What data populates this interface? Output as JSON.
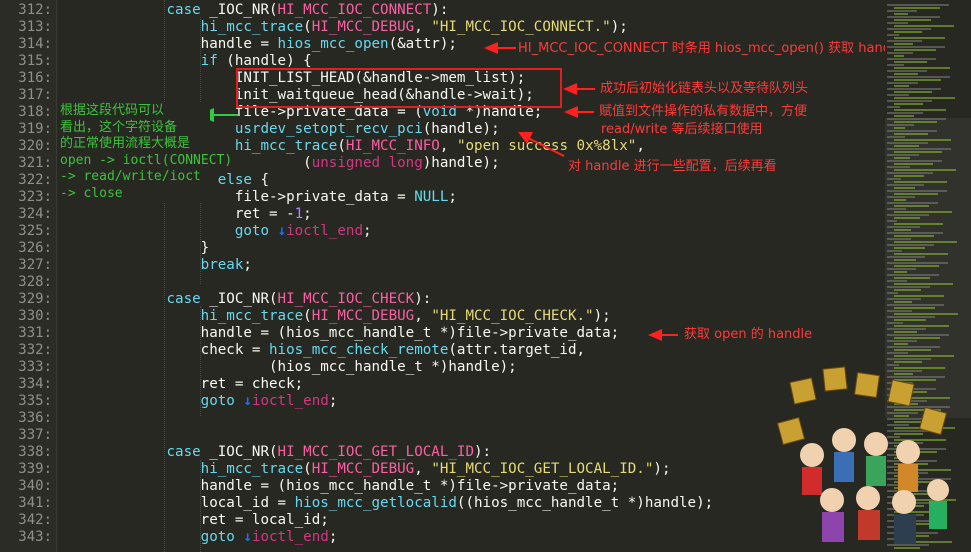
{
  "editor": {
    "lines": [
      {
        "n": "312:",
        "html": "            <span class=\"kw\">case</span> _IOC_NR(<span class=\"mac\">HI_MCC_IOC_CONNECT</span>):"
      },
      {
        "n": "313:",
        "html": "                <span class=\"fn\">hi_mcc_trace</span>(<span class=\"mac\">HI_MCC_DEBUG</span>, <span class=\"str\">\"HI_MCC_IOC_CONNECT.\"</span>);"
      },
      {
        "n": "314:",
        "html": "                handle = <span class=\"fn\">hios_mcc_open</span>(&amp;attr);"
      },
      {
        "n": "315:",
        "html": "                <span class=\"kw\">if</span> (handle) {"
      },
      {
        "n": "316:",
        "html": "                    INIT_LIST_HEAD(&amp;handle-&gt;mem_list);"
      },
      {
        "n": "317:",
        "html": "                    init_waitqueue_head(&amp;handle-&gt;wait);"
      },
      {
        "n": "318:",
        "html": "                    file-&gt;private_data = (<span class=\"kw\">void</span> *)handle;"
      },
      {
        "n": "319:",
        "html": "                    <span class=\"fn\">usrdev_setopt_recv_pci</span>(handle);"
      },
      {
        "n": "320:",
        "html": "                    <span class=\"fn\">hi_mcc_trace</span>(<span class=\"mac\">HI_MCC_INFO</span>, <span class=\"str\">\"open success 0x%8lx\"</span>,"
      },
      {
        "n": "321:",
        "html": "                            (<span class=\"ty\">unsigned long</span>)handle);"
      },
      {
        "n": "322:",
        "html": "                } <span class=\"kw\">else</span> {"
      },
      {
        "n": "323:",
        "html": "                    file-&gt;private_data = <span class=\"kw\">NULL</span>;"
      },
      {
        "n": "324:",
        "html": "                    ret = -<span class=\"num\">1</span>;"
      },
      {
        "n": "325:",
        "html": "                    <span class=\"kw\">goto</span> <span class=\"arrowD\">↓</span><span class=\"ty\">ioctl_end</span>;"
      },
      {
        "n": "326:",
        "html": "                }"
      },
      {
        "n": "327:",
        "html": "                <span class=\"kw\">break</span>;"
      },
      {
        "n": "328:",
        "html": ""
      },
      {
        "n": "329:",
        "html": "            <span class=\"kw\">case</span> _IOC_NR(<span class=\"mac\">HI_MCC_IOC_CHECK</span>):"
      },
      {
        "n": "330:",
        "html": "                <span class=\"fn\">hi_mcc_trace</span>(<span class=\"mac\">HI_MCC_DEBUG</span>, <span class=\"str\">\"HI_MCC_IOC_CHECK.\"</span>);"
      },
      {
        "n": "331:",
        "html": "                handle = (hios_mcc_handle_t *)file-&gt;private_data;"
      },
      {
        "n": "332:",
        "html": "                check = <span class=\"fn\">hios_mcc_check_remote</span>(attr.target_id,"
      },
      {
        "n": "333:",
        "html": "                        (hios_mcc_handle_t *)handle);"
      },
      {
        "n": "334:",
        "html": "                ret = check;"
      },
      {
        "n": "335:",
        "html": "                <span class=\"kw\">goto</span> <span class=\"arrowD\">↓</span><span class=\"ty\">ioctl_end</span>;"
      },
      {
        "n": "336:",
        "html": ""
      },
      {
        "n": "337:",
        "html": ""
      },
      {
        "n": "338:",
        "html": "            <span class=\"kw\">case</span> _IOC_NR(<span class=\"mac\">HI_MCC_IOC_GET_LOCAL_ID</span>):"
      },
      {
        "n": "339:",
        "html": "                <span class=\"fn\">hi_mcc_trace</span>(<span class=\"mac\">HI_MCC_DEBUG</span>, <span class=\"str\">\"HI_MCC_IOC_GET_LOCAL_ID.\"</span>);"
      },
      {
        "n": "340:",
        "html": "                handle = (hios_mcc_handle_t *)file-&gt;private_data;"
      },
      {
        "n": "341:",
        "html": "                local_id = <span class=\"fn\">hios_mcc_getlocalid</span>((hios_mcc_handle_t *)handle);"
      },
      {
        "n": "342:",
        "html": "                ret = local_id;"
      },
      {
        "n": "343:",
        "html": "                <span class=\"kw\">goto</span> <span class=\"arrowD\">↓</span><span class=\"ty\">ioctl_end</span>;"
      }
    ]
  },
  "annotations": {
    "note_open": "HI_MCC_IOC_CONNECT 时条用 hios_mcc_open() 获取 handle",
    "note_init": "成功后初始化链表头以及等待队列头",
    "note_private_1": "赋值到文件操作的私有数据中，方便",
    "note_private_2": "read/write 等后续接口使用",
    "note_config": "对 handle 进行一些配置，后续再看",
    "note_get_handle": "获取 open 的 handle",
    "side_note": "根据这段代码可以\n看出，这个字符设备\n的正常使用流程大概是\nopen -> ioctl(CONNECT)\n-> read/write/ioct\n-> close"
  },
  "colors": {
    "background": "#272822",
    "annotation_red": "#ff3a3a",
    "annotation_green": "#3cc43c"
  }
}
